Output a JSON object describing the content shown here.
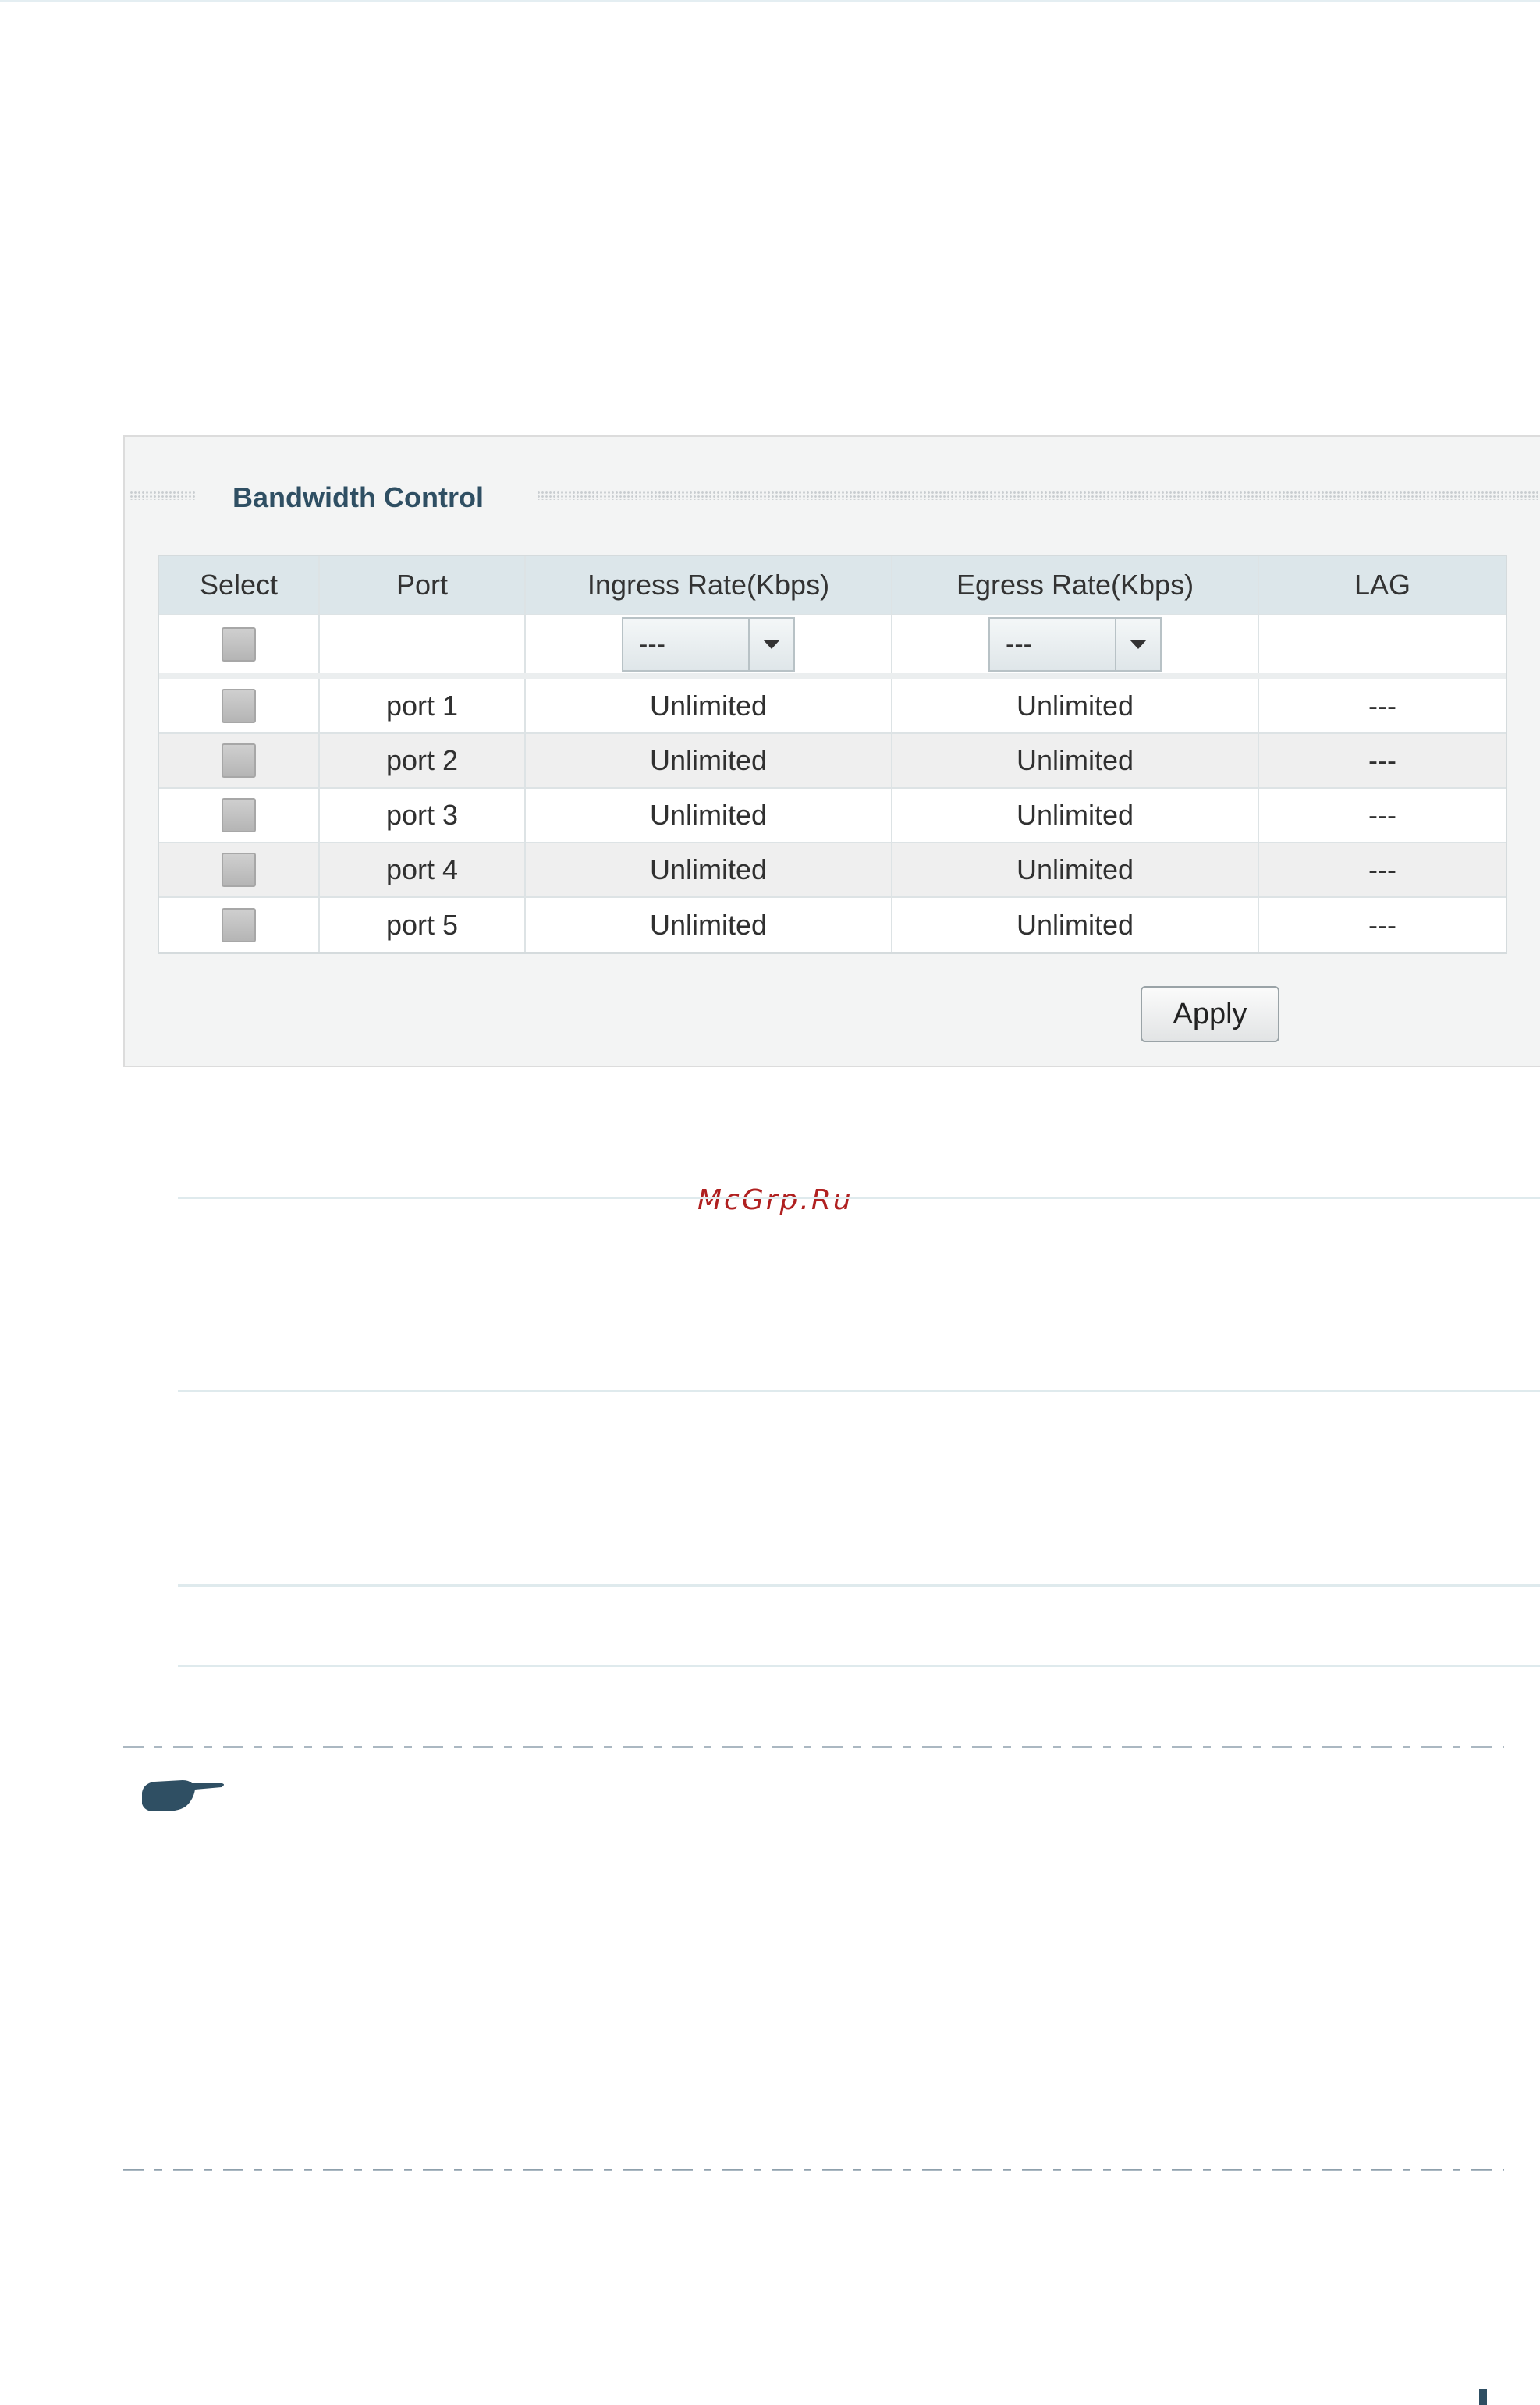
{
  "panel": {
    "title": "Bandwidth Control",
    "columns": {
      "select": "Select",
      "port": "Port",
      "ingress": "Ingress Rate(Kbps)",
      "egress": "Egress Rate(Kbps)",
      "lag": "LAG"
    },
    "config_row": {
      "ingress_select": "---",
      "egress_select": "---"
    },
    "rows": [
      {
        "port": "port 1",
        "ingress": "Unlimited",
        "egress": "Unlimited",
        "lag": "---"
      },
      {
        "port": "port 2",
        "ingress": "Unlimited",
        "egress": "Unlimited",
        "lag": "---"
      },
      {
        "port": "port 3",
        "ingress": "Unlimited",
        "egress": "Unlimited",
        "lag": "---"
      },
      {
        "port": "port 4",
        "ingress": "Unlimited",
        "egress": "Unlimited",
        "lag": "---"
      },
      {
        "port": "port 5",
        "ingress": "Unlimited",
        "egress": "Unlimited",
        "lag": "---"
      }
    ],
    "apply_label": "Apply"
  },
  "watermark": "McGrp.Ru",
  "icons": {
    "note": "pointing-hand-icon",
    "dropdown": "triangle-down-icon"
  },
  "colors": {
    "title": "#2f4f63",
    "header_bg": "#dce6ea",
    "watermark": "#b02020",
    "rule": "#dfeaed",
    "note_icon": "#2f4f63"
  }
}
